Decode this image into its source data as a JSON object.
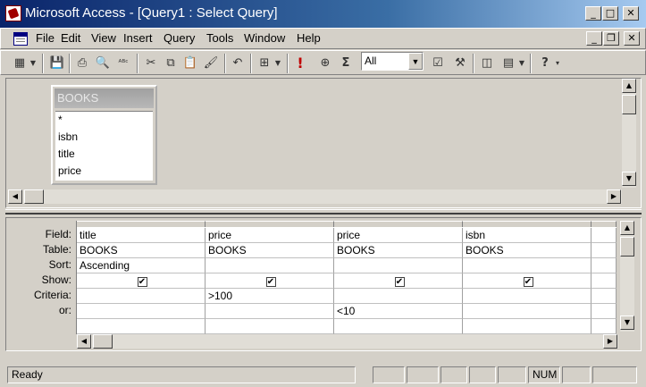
{
  "window": {
    "title": "Microsoft Access - [Query1 : Select Query]",
    "caption_buttons": [
      "_",
      "□",
      "✕"
    ],
    "doc_buttons": [
      "_",
      "❐",
      "✕"
    ]
  },
  "menu": [
    {
      "label": "File",
      "hot": "F"
    },
    {
      "label": "Edit",
      "hot": "E"
    },
    {
      "label": "View",
      "hot": "V"
    },
    {
      "label": "Insert",
      "hot": "I"
    },
    {
      "label": "Query",
      "hot": "Q"
    },
    {
      "label": "Tools",
      "hot": "T"
    },
    {
      "label": "Window",
      "hot": "W"
    },
    {
      "label": "Help",
      "hot": "H"
    }
  ],
  "toolbar": {
    "top_values": "All",
    "run_icon": "!",
    "totals_icon": "Σ",
    "help_icon": "?"
  },
  "table_box": {
    "name": "BOOKS",
    "fields": [
      "*",
      "isbn",
      "title",
      "price"
    ]
  },
  "grid": {
    "row_labels": [
      "Field:",
      "Table:",
      "Sort:",
      "Show:",
      "Criteria:",
      "or:"
    ],
    "columns": [
      {
        "field": "title",
        "table": "BOOKS",
        "sort": "Ascending",
        "show": "✔",
        "criteria": "",
        "or": ""
      },
      {
        "field": "price",
        "table": "BOOKS",
        "sort": "",
        "show": "✔",
        "criteria": ">100",
        "or": ""
      },
      {
        "field": "price",
        "table": "BOOKS",
        "sort": "",
        "show": "✔",
        "criteria": "",
        "or": "<10"
      },
      {
        "field": "isbn",
        "table": "BOOKS",
        "sort": "",
        "show": "✔",
        "criteria": "",
        "or": ""
      }
    ]
  },
  "status": {
    "text": "Ready",
    "num": "NUM"
  },
  "colors": {
    "titlebar_start": "#0a246a",
    "titlebar_end": "#a6caf0",
    "face": "#d4d0c8"
  }
}
